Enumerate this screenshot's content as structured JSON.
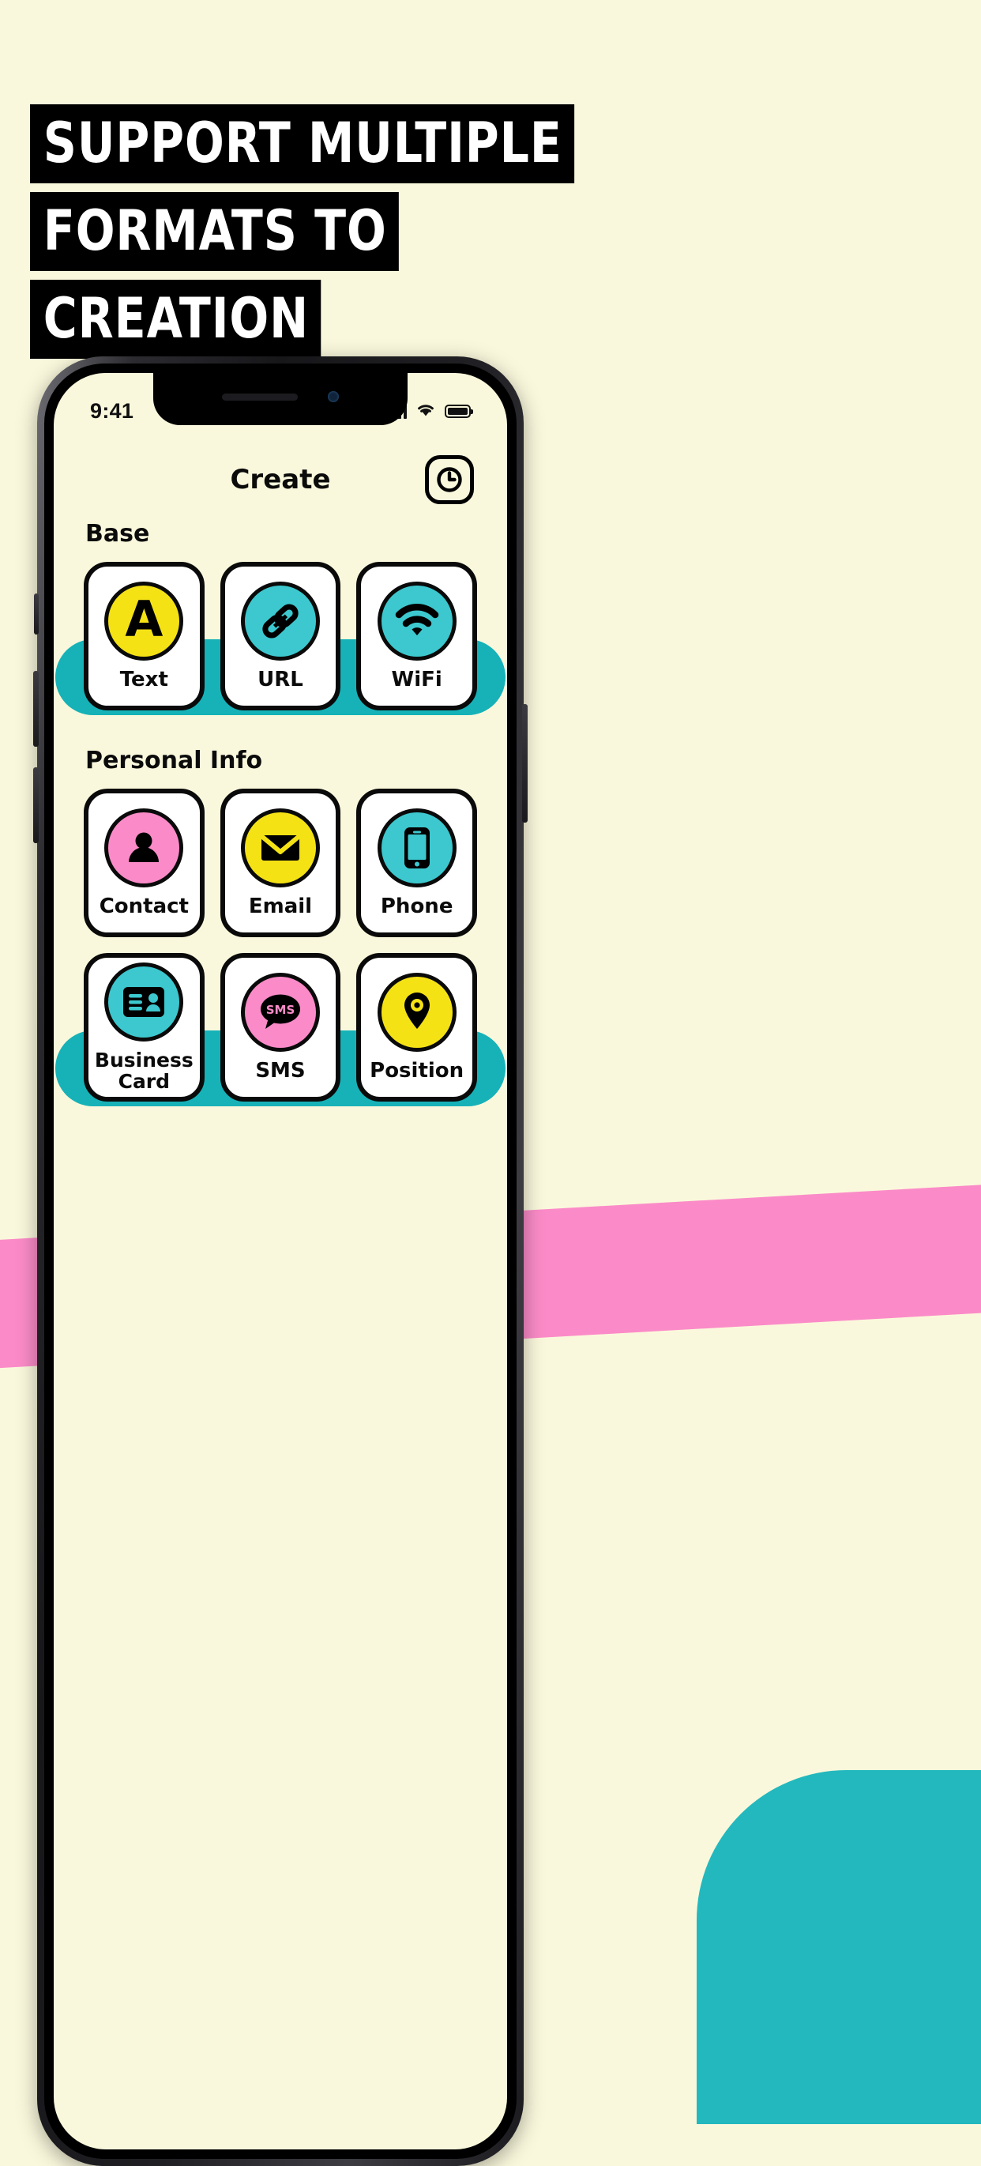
{
  "promo": {
    "headline_lines": [
      "SUPPORT MULTIPLE",
      "FORMATS TO",
      "CREATION"
    ],
    "background_color": "#FAF8DC",
    "headline_bg": "#000000",
    "headline_fg": "#FFFFFF",
    "accent_pink": "#FB8BC8",
    "accent_teal": "#16B2B8",
    "accent_yellow": "#F5E215"
  },
  "phone": {
    "status_bar": {
      "time": "9:41",
      "cellular_icon": "signal-bars-icon",
      "wifi_icon": "wifi-status-icon",
      "battery_icon": "battery-full-icon"
    },
    "header": {
      "title": "Create",
      "history_button_icon": "clock-history-icon"
    },
    "sections": [
      {
        "title": "Base",
        "items": [
          {
            "label": "Text",
            "icon": "letter-a-icon",
            "icon_color": "#F5E215"
          },
          {
            "label": "URL",
            "icon": "link-chain-icon",
            "icon_color": "#3CC8CE"
          },
          {
            "label": "WiFi",
            "icon": "wifi-icon",
            "icon_color": "#3CC8CE"
          }
        ]
      },
      {
        "title": "Personal Info",
        "items": [
          {
            "label": "Contact",
            "icon": "person-icon",
            "icon_color": "#FB8BC8"
          },
          {
            "label": "Email",
            "icon": "envelope-icon",
            "icon_color": "#F5E215"
          },
          {
            "label": "Phone",
            "icon": "smartphone-icon",
            "icon_color": "#3CC8CE"
          },
          {
            "label": "Business Card",
            "icon": "id-card-icon",
            "icon_color": "#3CC8CE"
          },
          {
            "label": "SMS",
            "icon": "sms-bubble-icon",
            "icon_color": "#FB8BC8"
          },
          {
            "label": "Position",
            "icon": "map-pin-icon",
            "icon_color": "#F5E215"
          }
        ]
      }
    ]
  }
}
